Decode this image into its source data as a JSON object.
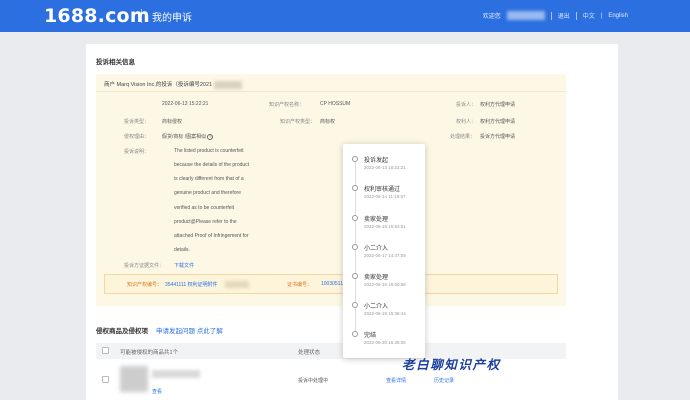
{
  "header": {
    "logo": "1688.com",
    "page_title": "我的申诉",
    "welcome": "欢迎您",
    "logout": "退出",
    "lang_cn": "中文",
    "lang_sep": "|",
    "lang_en": "English"
  },
  "complaint": {
    "section_title": "投诉相关信息",
    "head_text": "商户 Marq Vision Inc.的投诉（投诉编号2021",
    "date_value": "2022-06-13 15:22:21",
    "rights_label": "知识产权名称：",
    "rights_value": "CP HOSSUM",
    "role_label": "投诉人：",
    "role_value": "权利方代理申请",
    "type_label": "投诉类型：",
    "type_value": "商标侵权",
    "type2_label": "知识产权类型：",
    "type2_value": "商标权",
    "owner_label": "权利人：",
    "owner_value": "权利方代理申请",
    "reason_label": "侵权理由：",
    "reason_value": "假货",
    "reason_extra": "/商标 /图案相似",
    "result_label": "处理结果：",
    "result_value": "投诉方代理申请",
    "desc_label": "投诉说明：",
    "desc_lines": [
      "The listed product is counterfeit",
      "because the details of the product",
      "is clearly different from that of a",
      "genuine product and therefore",
      "verified as to be counterfeit",
      "product@Please refer to the",
      "attached Proof of Infringement for",
      "details."
    ],
    "attach_label": "投诉方证据文件：",
    "attach_link": "下载文件",
    "auth_label": "知识产权编号：",
    "auth_value": "35441111 权利证明附件",
    "cert_label": "证书编号：",
    "cert_value": "10030511"
  },
  "products": {
    "title": "侵权商品及侵权项",
    "link": "申请发起问题 点此了解",
    "header_name": "可能被侵权的商品共1个",
    "header_status": "处理状态",
    "row_link": "查看",
    "row_status": "投诉中处理中",
    "row_action1": "查看详情",
    "row_action2": "历史记录"
  },
  "timeline": [
    {
      "label": "投诉发起",
      "time": "2022-06-13 15:22:21"
    },
    {
      "label": "权利审核通过",
      "time": "2022-06-14 11:19:57"
    },
    {
      "label": "卖家处理",
      "time": "2022-06-16 15:53:51"
    },
    {
      "label": "小二介入",
      "time": "2022-06-17 14:47:09"
    },
    {
      "label": "卖家处理",
      "time": "2022-06-19 16:00:58"
    },
    {
      "label": "小二介入",
      "time": "2022-06-19 15:36:44"
    },
    {
      "label": "完结",
      "time": "2022-06-20 15:35:06"
    }
  ],
  "watermark": "老白聊知识产权",
  "colors": {
    "header_bg": "#2b6fe0",
    "info_bg": "#fdf8e6",
    "link": "#2b6fe0",
    "warning": "#e07b1c",
    "watermark": "#1d3f9e"
  }
}
